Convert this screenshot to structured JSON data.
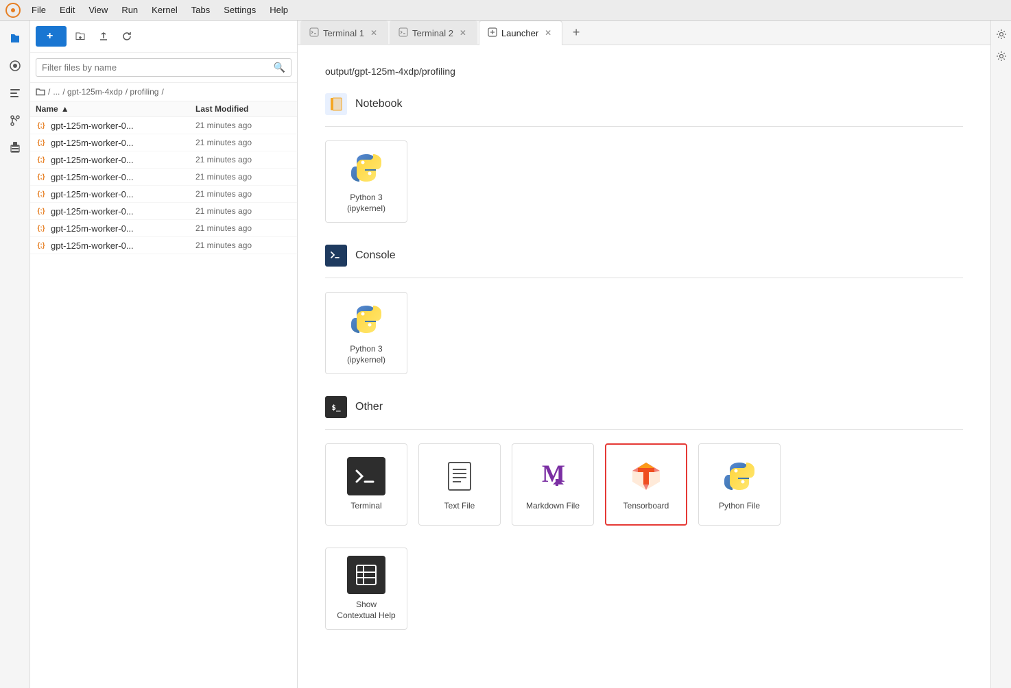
{
  "menu": {
    "items": [
      "File",
      "Edit",
      "View",
      "Run",
      "Kernel",
      "Tabs",
      "Settings",
      "Help"
    ]
  },
  "sidebar": {
    "search_placeholder": "Filter files by name",
    "breadcrumb": [
      "/ ",
      "... ",
      "/ gpt-125m-4xdp ",
      "/ profiling ",
      "/"
    ],
    "columns": {
      "name": "Name",
      "modified": "Last Modified"
    },
    "files": [
      {
        "name": "gpt-125m-worker-0...",
        "modified": "21 minutes ago"
      },
      {
        "name": "gpt-125m-worker-0...",
        "modified": "21 minutes ago"
      },
      {
        "name": "gpt-125m-worker-0...",
        "modified": "21 minutes ago"
      },
      {
        "name": "gpt-125m-worker-0...",
        "modified": "21 minutes ago"
      },
      {
        "name": "gpt-125m-worker-0...",
        "modified": "21 minutes ago"
      },
      {
        "name": "gpt-125m-worker-0...",
        "modified": "21 minutes ago"
      },
      {
        "name": "gpt-125m-worker-0...",
        "modified": "21 minutes ago"
      },
      {
        "name": "gpt-125m-worker-0...",
        "modified": "21 minutes ago"
      }
    ]
  },
  "tabs": [
    {
      "label": "Terminal 1",
      "icon": "terminal",
      "active": false
    },
    {
      "label": "Terminal 2",
      "icon": "terminal",
      "active": false
    },
    {
      "label": "Launcher",
      "icon": "launcher",
      "active": true
    }
  ],
  "launcher": {
    "path": "output/gpt-125m-4xdp/profiling",
    "sections": [
      {
        "title": "Notebook",
        "icon_type": "notebook",
        "cards": [
          {
            "label": "Python 3\n(ipykernel)",
            "type": "python3"
          }
        ]
      },
      {
        "title": "Console",
        "icon_type": "console",
        "cards": [
          {
            "label": "Python 3\n(ipykernel)",
            "type": "python3"
          }
        ]
      },
      {
        "title": "Other",
        "icon_type": "other",
        "cards": [
          {
            "label": "Terminal",
            "type": "terminal"
          },
          {
            "label": "Text File",
            "type": "textfile"
          },
          {
            "label": "Markdown File",
            "type": "markdown"
          },
          {
            "label": "Tensorboard",
            "type": "tensorboard",
            "selected": true
          },
          {
            "label": "Python File",
            "type": "pythonfile"
          }
        ]
      }
    ],
    "other_extra_cards": [
      {
        "label": "Show\nContextual Help",
        "type": "contextualhelp"
      }
    ]
  }
}
